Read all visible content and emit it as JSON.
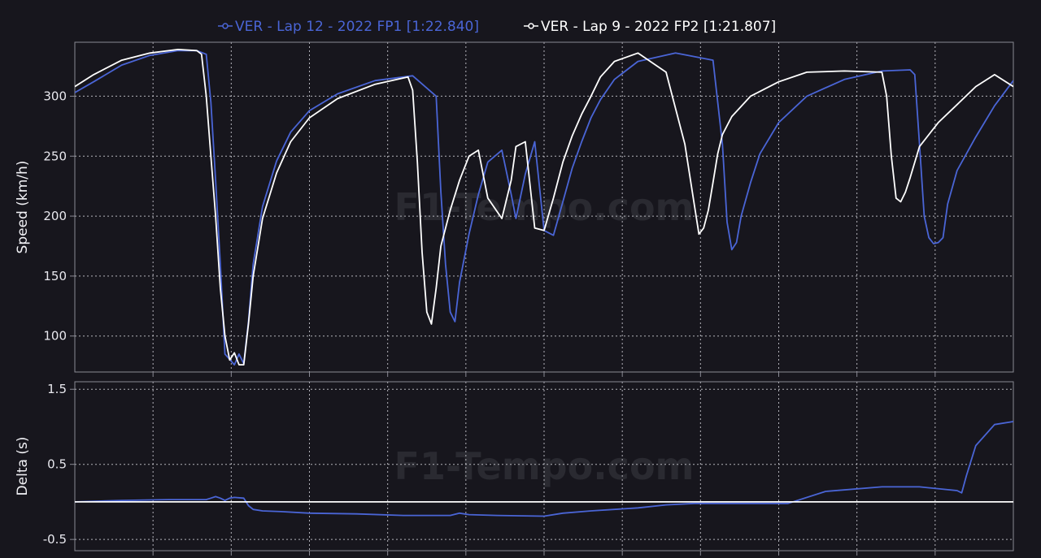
{
  "watermark": "F1-Tempo.com",
  "legend": [
    {
      "label": "VER - Lap 12 - 2022 FP1 [1:22.840]",
      "color": "#4a65d6"
    },
    {
      "label": "VER - Lap 9 - 2022 FP2 [1:21.807]",
      "color": "#ffffff"
    }
  ],
  "colors": {
    "background": "#17161d",
    "grid": "#cfcfd6",
    "axis": "#8a8a94",
    "text": "#e8e8ee",
    "zero_line": "#ffffff"
  },
  "chart_data": [
    {
      "type": "line",
      "ylabel": "Speed (km/h)",
      "xlim": [
        0,
        1.0
      ],
      "ylim": [
        70,
        345
      ],
      "yticks": [
        100,
        150,
        200,
        250,
        300
      ],
      "grid": true,
      "legend_position": "top-center",
      "series": [
        {
          "name": "VER - Lap 12 - 2022 FP1 [1:22.840]",
          "color": "#4a65d6",
          "x": [
            0,
            0.02,
            0.05,
            0.08,
            0.11,
            0.13,
            0.14,
            0.145,
            0.15,
            0.155,
            0.16,
            0.17,
            0.175,
            0.18,
            0.185,
            0.19,
            0.2,
            0.215,
            0.23,
            0.25,
            0.28,
            0.32,
            0.36,
            0.385,
            0.39,
            0.395,
            0.4,
            0.405,
            0.41,
            0.42,
            0.43,
            0.44,
            0.455,
            0.465,
            0.47,
            0.48,
            0.49,
            0.5,
            0.51,
            0.52,
            0.53,
            0.54,
            0.55,
            0.56,
            0.575,
            0.6,
            0.64,
            0.68,
            0.69,
            0.695,
            0.7,
            0.705,
            0.71,
            0.72,
            0.73,
            0.75,
            0.78,
            0.82,
            0.86,
            0.89,
            0.895,
            0.9,
            0.905,
            0.91,
            0.915,
            0.92,
            0.925,
            0.93,
            0.94,
            0.96,
            0.98,
            1.0
          ],
          "values": [
            303,
            312,
            326,
            334,
            338,
            338,
            335,
            295,
            230,
            160,
            85,
            76,
            85,
            77,
            112,
            160,
            208,
            246,
            270,
            288,
            302,
            313,
            317,
            300,
            220,
            160,
            120,
            112,
            145,
            185,
            218,
            245,
            255,
            218,
            198,
            235,
            262,
            188,
            184,
            212,
            240,
            262,
            282,
            297,
            314,
            329,
            336,
            330,
            260,
            195,
            172,
            178,
            200,
            228,
            252,
            278,
            300,
            314,
            321,
            322,
            318,
            260,
            200,
            182,
            177,
            178,
            182,
            210,
            238,
            266,
            292,
            313
          ]
        },
        {
          "name": "VER - Lap 9 - 2022 FP2 [1:21.807]",
          "color": "#ffffff",
          "x": [
            0,
            0.02,
            0.05,
            0.08,
            0.11,
            0.13,
            0.135,
            0.14,
            0.145,
            0.15,
            0.155,
            0.16,
            0.165,
            0.17,
            0.175,
            0.18,
            0.185,
            0.19,
            0.2,
            0.215,
            0.23,
            0.25,
            0.28,
            0.32,
            0.355,
            0.36,
            0.365,
            0.37,
            0.375,
            0.38,
            0.385,
            0.39,
            0.4,
            0.41,
            0.42,
            0.43,
            0.44,
            0.455,
            0.465,
            0.47,
            0.48,
            0.49,
            0.5,
            0.51,
            0.52,
            0.53,
            0.54,
            0.55,
            0.56,
            0.575,
            0.6,
            0.63,
            0.65,
            0.66,
            0.665,
            0.67,
            0.675,
            0.68,
            0.685,
            0.69,
            0.7,
            0.72,
            0.75,
            0.78,
            0.82,
            0.86,
            0.865,
            0.87,
            0.875,
            0.88,
            0.885,
            0.89,
            0.9,
            0.92,
            0.94,
            0.96,
            0.98,
            1.0
          ],
          "values": [
            308,
            318,
            330,
            336,
            339,
            338,
            335,
            300,
            250,
            200,
            140,
            100,
            80,
            86,
            76,
            76,
            110,
            150,
            198,
            236,
            262,
            282,
            298,
            310,
            316,
            305,
            245,
            170,
            120,
            110,
            140,
            175,
            205,
            230,
            250,
            255,
            215,
            198,
            230,
            258,
            262,
            190,
            188,
            215,
            245,
            267,
            285,
            300,
            316,
            329,
            336,
            320,
            260,
            210,
            185,
            190,
            205,
            228,
            252,
            268,
            283,
            300,
            312,
            320,
            321,
            320,
            300,
            250,
            215,
            212,
            220,
            232,
            258,
            278,
            293,
            308,
            318,
            308
          ]
        }
      ]
    },
    {
      "type": "line",
      "ylabel": "Delta (s)",
      "xlim": [
        0,
        1.0
      ],
      "ylim": [
        -0.65,
        1.6
      ],
      "yticks": [
        -0.5,
        0.5,
        1.5
      ],
      "grid": true,
      "reference_line": 0,
      "series": [
        {
          "name": "VER - Lap 12 - 2022 FP1 [1:22.840]",
          "color": "#4a65d6",
          "x": [
            0,
            0.05,
            0.1,
            0.14,
            0.145,
            0.15,
            0.155,
            0.16,
            0.165,
            0.17,
            0.18,
            0.185,
            0.19,
            0.2,
            0.22,
            0.25,
            0.3,
            0.35,
            0.4,
            0.41,
            0.42,
            0.45,
            0.5,
            0.52,
            0.55,
            0.6,
            0.63,
            0.66,
            0.7,
            0.76,
            0.8,
            0.86,
            0.9,
            0.94,
            0.945,
            0.95,
            0.96,
            0.98,
            1.0
          ],
          "values": [
            0.0,
            0.02,
            0.03,
            0.03,
            0.05,
            0.07,
            0.05,
            0.02,
            0.05,
            0.06,
            0.05,
            -0.05,
            -0.1,
            -0.12,
            -0.13,
            -0.15,
            -0.16,
            -0.18,
            -0.18,
            -0.15,
            -0.17,
            -0.18,
            -0.19,
            -0.15,
            -0.12,
            -0.08,
            -0.04,
            -0.02,
            -0.02,
            -0.02,
            0.14,
            0.2,
            0.2,
            0.15,
            0.12,
            0.35,
            0.75,
            1.03,
            1.07
          ]
        },
        {
          "name": "VER - Lap 9 - 2022 FP2 [1:21.807]",
          "color": "#ffffff",
          "x": [
            0,
            1.0
          ],
          "values": [
            0,
            0
          ]
        }
      ]
    }
  ]
}
